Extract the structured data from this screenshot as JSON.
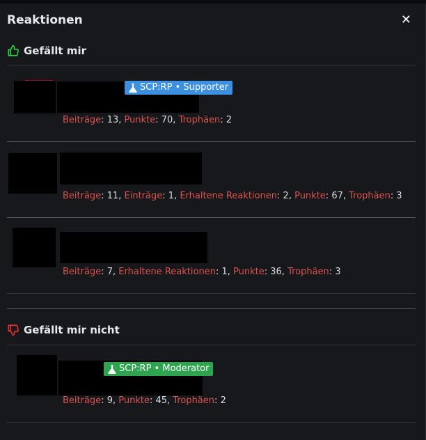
{
  "dialog": {
    "title": "Reaktionen"
  },
  "sections": [
    {
      "heading": "Gefällt mir",
      "icon": "thumbs-up-icon",
      "color": "#2ecc40",
      "users": [
        {
          "badge": {
            "label": "SCP:RP • Supporter",
            "color": "#3d8fe0"
          },
          "stats": [
            {
              "key": "Beiträge",
              "value": "13"
            },
            {
              "key": "Punkte",
              "value": "70"
            },
            {
              "key": "Trophäen",
              "value": "2"
            }
          ]
        },
        {
          "stats": [
            {
              "key": "Beiträge",
              "value": "11"
            },
            {
              "key": "Einträge",
              "value": "1"
            },
            {
              "key": "Erhaltene Reaktionen",
              "value": "2"
            },
            {
              "key": "Punkte",
              "value": "67"
            },
            {
              "key": "Trophäen",
              "value": "3"
            }
          ]
        },
        {
          "stats": [
            {
              "key": "Beiträge",
              "value": "7"
            },
            {
              "key": "Erhaltene Reaktionen",
              "value": "1"
            },
            {
              "key": "Punkte",
              "value": "36"
            },
            {
              "key": "Trophäen",
              "value": "3"
            }
          ]
        }
      ]
    },
    {
      "heading": "Gefällt mir nicht",
      "icon": "thumbs-down-icon",
      "color": "#e03131",
      "users": [
        {
          "badge": {
            "label": "SCP:RP • Moderator",
            "color": "#2fa44f"
          },
          "stats": [
            {
              "key": "Beiträge",
              "value": "9"
            },
            {
              "key": "Punkte",
              "value": "45"
            },
            {
              "key": "Trophäen",
              "value": "2"
            }
          ]
        }
      ]
    }
  ]
}
